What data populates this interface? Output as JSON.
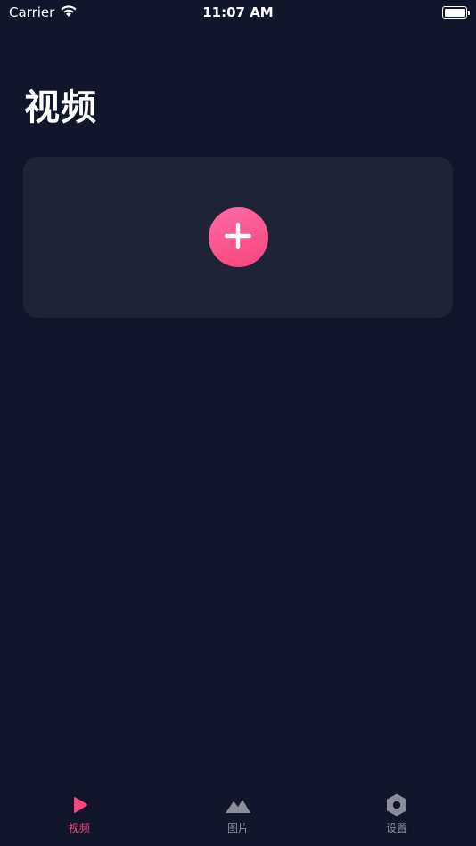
{
  "status_bar": {
    "carrier": "Carrier",
    "time": "11:07 AM"
  },
  "page": {
    "title": "视频"
  },
  "add_card": {
    "button_icon": "plus-icon"
  },
  "tab_bar": {
    "tabs": [
      {
        "label": "视频",
        "icon": "play-icon",
        "active": true
      },
      {
        "label": "图片",
        "icon": "mountain-icon",
        "active": false
      },
      {
        "label": "设置",
        "icon": "hexagon-settings-icon",
        "active": false
      }
    ]
  },
  "colors": {
    "background": "#11162a",
    "card": "#1f2336",
    "accent": "#f7467b",
    "inactive": "#8a8d99"
  }
}
